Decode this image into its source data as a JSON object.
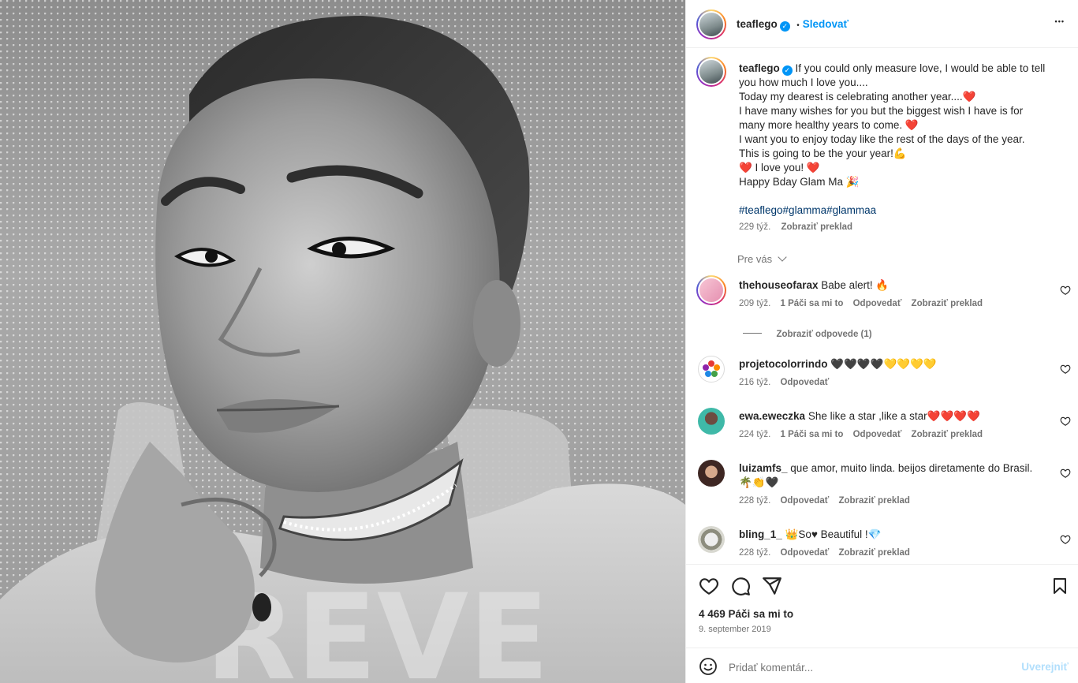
{
  "post": {
    "username": "teaflego",
    "follow_label": "Sledovať",
    "dot": "•",
    "more_label": "•••",
    "caption_lines": [
      "If you could only measure love, I would be able to tell",
      "you how much I love you....",
      "Today my dearest is celebrating another year....❤️",
      "I have many wishes for you but the biggest wish I have is for",
      "many more healthy years to come. ❤️",
      "I want you to enjoy today like the rest of the days of the year.",
      "This is going to be the your year!💪",
      "❤️ I love you! ❤️",
      "Happy Bday Glam Ma 🎉"
    ],
    "hashtags": "#teaflego#glamma#glammaa",
    "caption_time": "229 týž.",
    "caption_translate": "Zobraziť preklad",
    "sort_label": "Pre vás",
    "likes": "4 469 Páči sa mi to",
    "date": "9. september 2019",
    "comment_placeholder": "Pridať komentár...",
    "post_button": "Uverejniť"
  },
  "comments": [
    {
      "user": "thehouseofarax",
      "text": "Babe alert! 🔥",
      "time": "209 týž.",
      "likes": "1 Páči sa mi to",
      "reply": "Odpovedať",
      "translate": "Zobraziť preklad",
      "avatar_color": "#f4b8c9",
      "ring": true
    },
    {
      "user": "projetocolorrindo",
      "text": "🖤🖤🖤🖤💛💛💛💛",
      "time": "216 týž.",
      "likes": "",
      "reply": "Odpovedať",
      "translate": "",
      "avatar_color": "#ffffff",
      "ring": false
    },
    {
      "user": "ewa.eweczka",
      "text": "She like a star ,like a star❤️❤️❤️❤️",
      "time": "224 týž.",
      "likes": "1 Páči sa mi to",
      "reply": "Odpovedať",
      "translate": "Zobraziť preklad",
      "avatar_color": "#3fb9a8",
      "ring": false
    },
    {
      "user": "luizamfs_",
      "text": "que amor, muito linda. beijos diretamente do Brasil.",
      "text2": "🌴👏🖤",
      "time": "228 týž.",
      "likes": "",
      "reply": "Odpovedať",
      "translate": "Zobraziť preklad",
      "avatar_color": "#6b3f33",
      "ring": false
    },
    {
      "user": "bling_1_",
      "text": "👑So♥ Beautiful !💎",
      "time": "228 týž.",
      "likes": "",
      "reply": "Odpovedať",
      "translate": "Zobraziť preklad",
      "avatar_color": "#9e9e8e",
      "ring": false
    }
  ],
  "replies_toggle": "Zobraziť odpovede (1)",
  "colors": {
    "accent": "#0095f6",
    "text": "#262626",
    "muted": "#737373",
    "hashtag": "#00376b",
    "divider": "#efefef"
  }
}
